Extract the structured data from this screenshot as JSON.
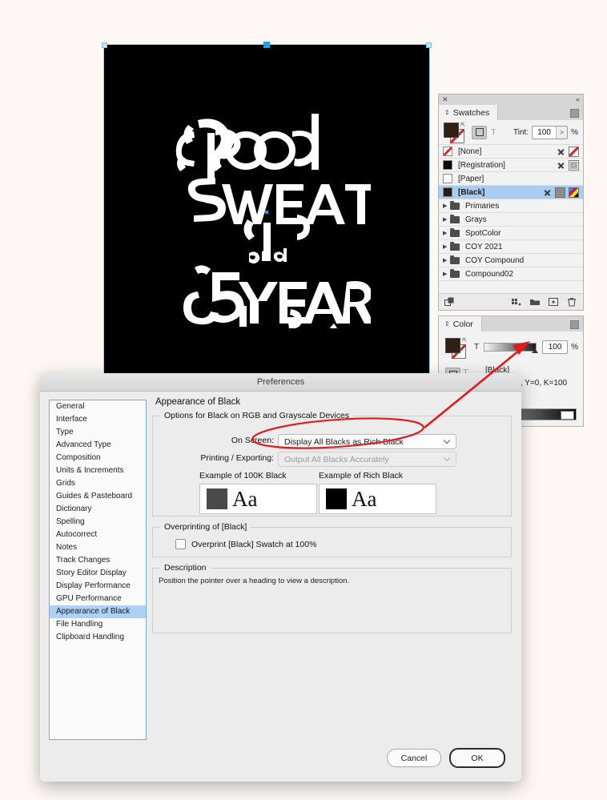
{
  "artwork": {
    "title_lines": [
      "Blood",
      "Sweat",
      "and",
      "5 Years"
    ],
    "description": "White decorative interlocking lettering on a solid black rectangle"
  },
  "swatches_panel": {
    "tab_label": "Swatches",
    "close_icon": "close-icon",
    "collapse_icon": "double-chevron-left-icon",
    "menu_icon": "panel-menu-icon",
    "tint": {
      "label": "Tint:",
      "value": "100",
      "unit": "%",
      "stepper": ">"
    },
    "fill_color": "#311f16",
    "stroke_none": true,
    "rows": [
      {
        "name": "[None]",
        "chip": "none",
        "icons": [
          "x-icon",
          "slash-icon"
        ],
        "selected": false
      },
      {
        "name": "[Registration]",
        "chip": "black",
        "icons": [
          "x-icon",
          "grid-icon"
        ],
        "selected": false
      },
      {
        "name": "[Paper]",
        "chip": "paper",
        "icons": [],
        "selected": false
      },
      {
        "name": "[Black]",
        "chip": "blackish",
        "icons": [
          "x-icon",
          "gray-icon",
          "cmyk-icon"
        ],
        "selected": true
      }
    ],
    "groups": [
      {
        "name": "Primaries"
      },
      {
        "name": "Grays"
      },
      {
        "name": "SpotColor"
      },
      {
        "name": "COY 2021"
      },
      {
        "name": "COY Compound"
      },
      {
        "name": "Compound02"
      }
    ],
    "footer_icons": [
      "show-swatch-groups-icon",
      "new-color-group-icon",
      "new-folder-icon",
      "new-swatch-icon",
      "delete-swatch-icon"
    ]
  },
  "color_panel": {
    "tab_label": "Color",
    "menu_icon": "panel-menu-icon",
    "slider_label": "T",
    "slider_value": "100",
    "slider_unit": "%",
    "swatch_name": "[Black]",
    "swatch_values": "C=0, M=0, Y=0, K=100"
  },
  "preferences": {
    "title": "Preferences",
    "sidebar": [
      {
        "label": "General",
        "active": false
      },
      {
        "label": "Interface",
        "active": false
      },
      {
        "label": "Type",
        "active": false
      },
      {
        "label": "Advanced Type",
        "active": false
      },
      {
        "label": "Composition",
        "active": false
      },
      {
        "label": "Units & Increments",
        "active": false
      },
      {
        "label": "Grids",
        "active": false
      },
      {
        "label": "Guides & Pasteboard",
        "active": false
      },
      {
        "label": "Dictionary",
        "active": false
      },
      {
        "label": "Spelling",
        "active": false
      },
      {
        "label": "Autocorrect",
        "active": false
      },
      {
        "label": "Notes",
        "active": false
      },
      {
        "label": "Track Changes",
        "active": false
      },
      {
        "label": "Story Editor Display",
        "active": false
      },
      {
        "label": "Display Performance",
        "active": false
      },
      {
        "label": "GPU Performance",
        "active": false
      },
      {
        "label": "Appearance of Black",
        "active": true
      },
      {
        "label": "File Handling",
        "active": false
      },
      {
        "label": "Clipboard Handling",
        "active": false
      }
    ],
    "pane_title": "Appearance of Black",
    "options_group": {
      "legend": "Options for Black on RGB and Grayscale Devices",
      "on_screen": {
        "label": "On Screen:",
        "value": "Display All Blacks as Rich Black",
        "disabled": false
      },
      "printing_exporting": {
        "label": "Printing / Exporting:",
        "value": "Output All Blacks Accurately",
        "disabled": true
      },
      "example_100k_label": "Example of 100K Black",
      "example_rich_label": "Example of Rich Black",
      "example_100k_color": "#4a4a4a",
      "example_rich_color": "#000000",
      "example_text": "Aa"
    },
    "overprint_group": {
      "legend": "Overprinting of [Black]",
      "checkbox_label": "Overprint [Black] Swatch at 100%",
      "checked": false
    },
    "description_group": {
      "legend": "Description",
      "text": "Position the pointer over a heading to view a description."
    },
    "buttons": {
      "cancel": "Cancel",
      "ok": "OK"
    }
  },
  "annotation": {
    "color": "#e01b1b",
    "ellipse_target": "on-screen-dropdown",
    "arrow_target": "color-panel-cmyk-values"
  }
}
